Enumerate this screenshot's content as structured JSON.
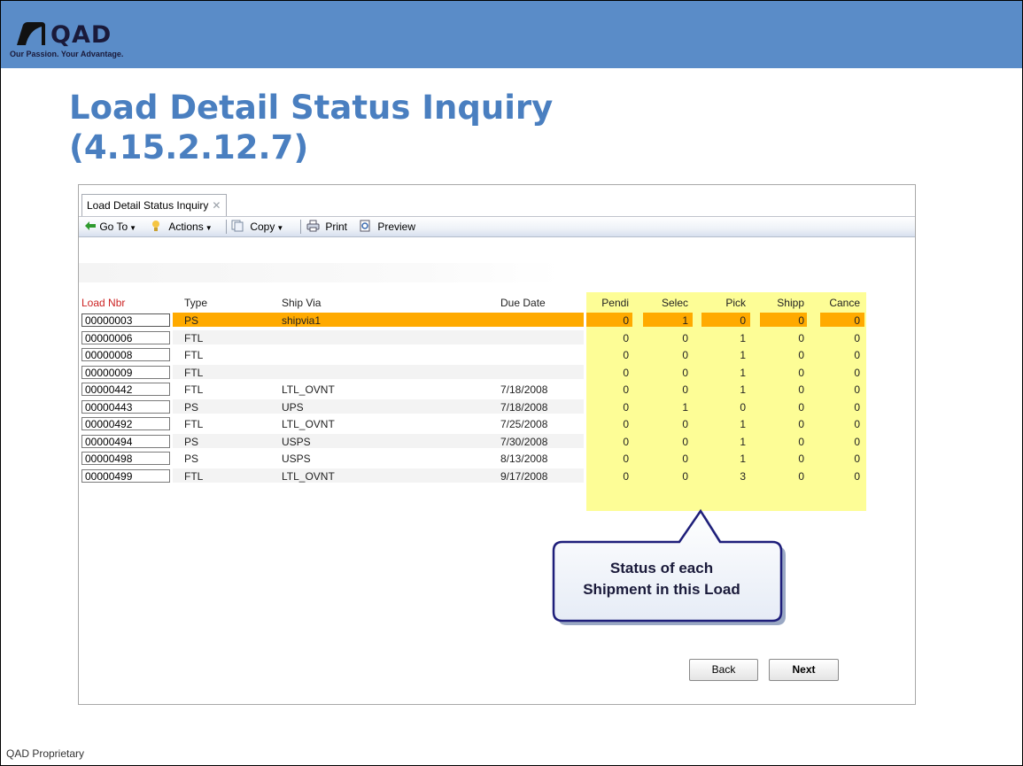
{
  "slide": {
    "logo_text": "QAD",
    "tagline": "Our Passion. Your Advantage.",
    "title_line1": "Load Detail Status Inquiry",
    "title_line2": "(4.15.2.12.7)",
    "footer": "QAD Proprietary"
  },
  "colors": {
    "banner": "#5a8cc8",
    "title": "#4a7fc0",
    "selected_row": "#ffaa00",
    "status_columns": "#fdfd96",
    "load_nbr_header": "#cc2222"
  },
  "window": {
    "tab_label": "Load Detail Status Inquiry",
    "tab_close_icon": "close-x-icon",
    "toolbar": {
      "goto_label": "Go To",
      "actions_label": "Actions",
      "copy_label": "Copy",
      "print_label": "Print",
      "preview_label": "Preview"
    }
  },
  "table": {
    "headers": {
      "load_nbr": "Load Nbr",
      "type": "Type",
      "ship_via": "Ship Via",
      "due_date": "Due Date",
      "pending": "Pendi",
      "selected": "Selec",
      "pick": "Pick",
      "shipped": "Shipp",
      "cancel": "Cance"
    },
    "rows": [
      {
        "load_nbr": "00000003",
        "type": "PS",
        "ship_via": "shipvia1",
        "due_date": "",
        "pending": "0",
        "selected": "1",
        "pick": "0",
        "shipped": "0",
        "cancel": "0",
        "selected_row": true
      },
      {
        "load_nbr": "00000006",
        "type": "FTL",
        "ship_via": "",
        "due_date": "",
        "pending": "0",
        "selected": "0",
        "pick": "1",
        "shipped": "0",
        "cancel": "0"
      },
      {
        "load_nbr": "00000008",
        "type": "FTL",
        "ship_via": "",
        "due_date": "",
        "pending": "0",
        "selected": "0",
        "pick": "1",
        "shipped": "0",
        "cancel": "0"
      },
      {
        "load_nbr": "00000009",
        "type": "FTL",
        "ship_via": "",
        "due_date": "",
        "pending": "0",
        "selected": "0",
        "pick": "1",
        "shipped": "0",
        "cancel": "0"
      },
      {
        "load_nbr": "00000442",
        "type": "FTL",
        "ship_via": "LTL_OVNT",
        "due_date": "7/18/2008",
        "pending": "0",
        "selected": "0",
        "pick": "1",
        "shipped": "0",
        "cancel": "0"
      },
      {
        "load_nbr": "00000443",
        "type": "PS",
        "ship_via": "UPS",
        "due_date": "7/18/2008",
        "pending": "0",
        "selected": "1",
        "pick": "0",
        "shipped": "0",
        "cancel": "0"
      },
      {
        "load_nbr": "00000492",
        "type": "FTL",
        "ship_via": "LTL_OVNT",
        "due_date": "7/25/2008",
        "pending": "0",
        "selected": "0",
        "pick": "1",
        "shipped": "0",
        "cancel": "0"
      },
      {
        "load_nbr": "00000494",
        "type": "PS",
        "ship_via": "USPS",
        "due_date": "7/30/2008",
        "pending": "0",
        "selected": "0",
        "pick": "1",
        "shipped": "0",
        "cancel": "0"
      },
      {
        "load_nbr": "00000498",
        "type": "PS",
        "ship_via": "USPS",
        "due_date": "8/13/2008",
        "pending": "0",
        "selected": "0",
        "pick": "1",
        "shipped": "0",
        "cancel": "0"
      },
      {
        "load_nbr": "00000499",
        "type": "FTL",
        "ship_via": "LTL_OVNT",
        "due_date": "9/17/2008",
        "pending": "0",
        "selected": "0",
        "pick": "3",
        "shipped": "0",
        "cancel": "0"
      }
    ]
  },
  "callout": {
    "line1": "Status of each",
    "line2": "Shipment in this Load"
  },
  "buttons": {
    "back": "Back",
    "next": "Next"
  }
}
